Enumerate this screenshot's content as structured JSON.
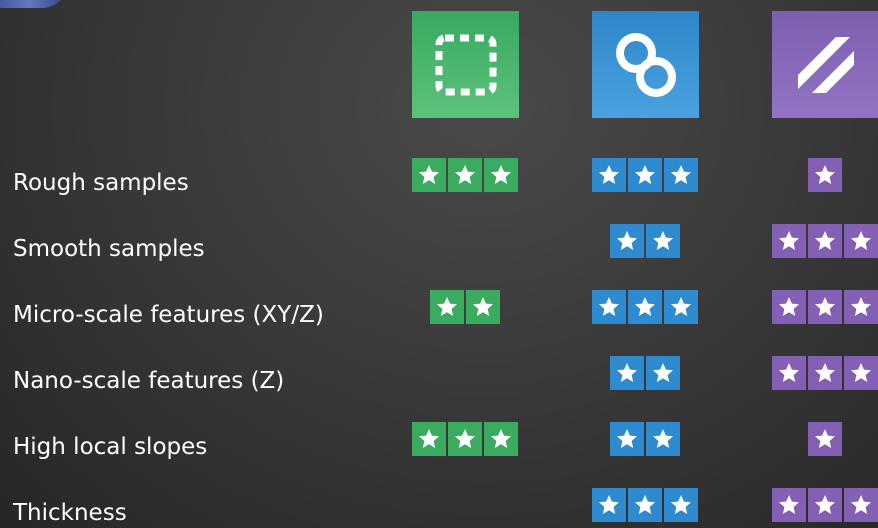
{
  "methods": [
    {
      "id": "green",
      "color": "#3aab5f",
      "icon": "dashed-square-icon"
    },
    {
      "id": "blue",
      "color": "#2e8bd0",
      "icon": "linked-rings-icon"
    },
    {
      "id": "purple",
      "color": "#8460b5",
      "icon": "diagonal-stripes-icon"
    }
  ],
  "rows": [
    {
      "label": "Rough samples",
      "ratings": [
        3,
        3,
        1
      ]
    },
    {
      "label": "Smooth samples",
      "ratings": [
        0,
        2,
        3
      ]
    },
    {
      "label": "Micro-scale features (XY/Z)",
      "ratings": [
        2,
        3,
        3
      ]
    },
    {
      "label": "Nano-scale features (Z)",
      "ratings": [
        0,
        2,
        3
      ]
    },
    {
      "label": "High local slopes",
      "ratings": [
        3,
        2,
        1
      ]
    },
    {
      "label": "Thickness",
      "ratings": [
        0,
        3,
        3
      ]
    }
  ]
}
